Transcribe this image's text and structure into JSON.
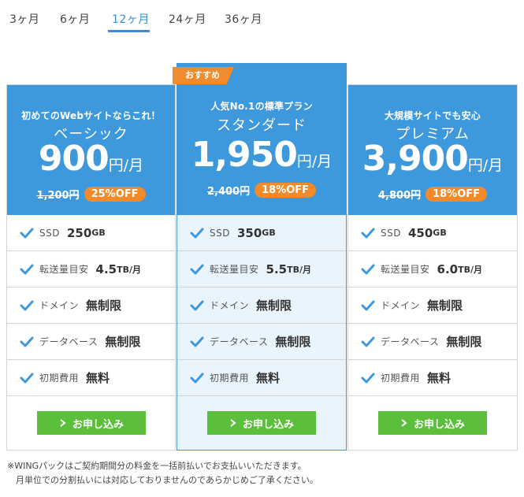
{
  "tabs": [
    {
      "label": "3ヶ月"
    },
    {
      "label": "6ヶ月"
    },
    {
      "label": "12ヶ月",
      "active": true
    },
    {
      "label": "24ヶ月"
    },
    {
      "label": "36ヶ月"
    }
  ],
  "colors": {
    "accent_blue": "#3d98dc",
    "offer_orange": "#f28a2a",
    "apply_green": "#5cbf3b",
    "recommended_bg": "#eaf4fc"
  },
  "plans": [
    {
      "tagline": "初めてのWebサイトならこれ！",
      "name": "ベーシック",
      "price": "900",
      "unit": "円/月",
      "old_price": "1,200円",
      "discount": "25%OFF",
      "features": [
        {
          "label": "SSD",
          "value": "250",
          "unit": "GB"
        },
        {
          "label": "転送量目安",
          "value": "4.5",
          "unit": "TB/月"
        },
        {
          "label": "ドメイン",
          "value": "無制限",
          "unit": ""
        },
        {
          "label": "データベース",
          "value": "無制限",
          "unit": ""
        },
        {
          "label": "初期費用",
          "value": "無料",
          "unit": ""
        }
      ],
      "button": "お申し込み"
    },
    {
      "badge": "おすすめ",
      "tagline": "人気No.1の標準プラン",
      "name": "スタンダード",
      "price": "1,950",
      "unit": "円/月",
      "old_price": "2,400円",
      "discount": "18%OFF",
      "features": [
        {
          "label": "SSD",
          "value": "350",
          "unit": "GB"
        },
        {
          "label": "転送量目安",
          "value": "5.5",
          "unit": "TB/月"
        },
        {
          "label": "ドメイン",
          "value": "無制限",
          "unit": ""
        },
        {
          "label": "データベース",
          "value": "無制限",
          "unit": ""
        },
        {
          "label": "初期費用",
          "value": "無料",
          "unit": ""
        }
      ],
      "button": "お申し込み"
    },
    {
      "tagline": "大規模サイトでも安心",
      "name": "プレミアム",
      "price": "3,900",
      "unit": "円/月",
      "old_price": "4,800円",
      "discount": "18%OFF",
      "features": [
        {
          "label": "SSD",
          "value": "450",
          "unit": "GB"
        },
        {
          "label": "転送量目安",
          "value": "6.0",
          "unit": "TB/月"
        },
        {
          "label": "ドメイン",
          "value": "無制限",
          "unit": ""
        },
        {
          "label": "データベース",
          "value": "無制限",
          "unit": ""
        },
        {
          "label": "初期費用",
          "value": "無料",
          "unit": ""
        }
      ],
      "button": "お申し込み"
    }
  ],
  "notes": [
    "※WINGパックはご契約期間分の料金を一括前払いでお支払いいただきます。",
    "月単位での分割払いには対応しておりませんのであらかじめご了承ください。"
  ]
}
